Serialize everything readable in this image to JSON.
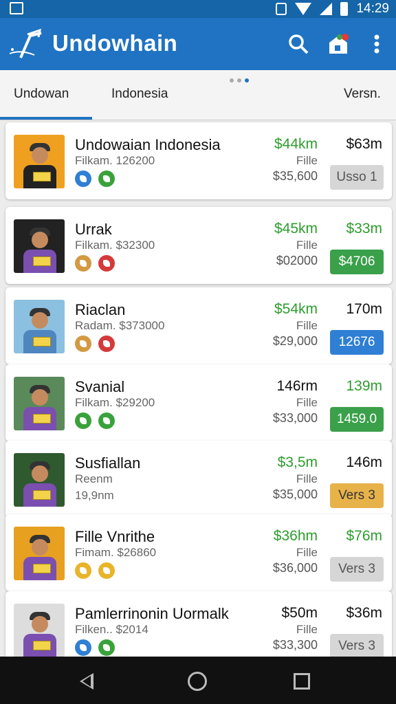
{
  "status_bar": {
    "time": "14:29"
  },
  "app_bar": {
    "title": "Undowhain",
    "accent": "#1f73c2"
  },
  "tabs": [
    {
      "label": "Undowan",
      "selected": true
    },
    {
      "label": "Indonesia",
      "selected": false
    },
    {
      "label": "Versn.",
      "selected": false
    }
  ],
  "items": [
    {
      "name": "Undowaian Indonesia",
      "sub": "Filkam. 126200",
      "sub2": "",
      "v1": "$44km",
      "v1_color": "#2e9c2e",
      "label": "Fille",
      "v3": "$35,600",
      "v2": "$63m",
      "v2_color": "#111111",
      "badge": "Usso 1",
      "badge_bg": "#d6d6d6",
      "badge_fg": "#555555",
      "icons": [
        "#2f7fd4",
        "#3aa23a"
      ],
      "thumb_bg": "#f0a020",
      "thumb_body": "#222222"
    },
    {
      "name": "Urrak",
      "sub": "Filkam. $32300",
      "sub2": "",
      "v1": "$45km",
      "v1_color": "#2e9c2e",
      "label": "Fille",
      "v3": "$02000",
      "v2": "$33m",
      "v2_color": "#2e9c2e",
      "badge": "$4706",
      "badge_bg": "#3aa04a",
      "badge_fg": "#ffffff",
      "icons": [
        "#d39a42",
        "#d43a3a"
      ],
      "thumb_bg": "#222222",
      "thumb_body": "#7a4fb0"
    },
    {
      "name": "Riaclan",
      "sub": "Radam. $373000",
      "sub2": "",
      "v1": "$54km",
      "v1_color": "#2e9c2e",
      "label": "Fille",
      "v3": "$29,000",
      "v2": "170m",
      "v2_color": "#111111",
      "badge": "12676",
      "badge_bg": "#2f7fd4",
      "badge_fg": "#ffffff",
      "icons": [
        "#d39a42",
        "#d43a3a"
      ],
      "thumb_bg": "#8cc0e0",
      "thumb_body": "#4f86c0"
    },
    {
      "name": "Svanial",
      "sub": "Filkam. $29200",
      "sub2": "",
      "v1": "146rm",
      "v1_color": "#111111",
      "label": "Fille",
      "v3": "$33,000",
      "v2": "139m",
      "v2_color": "#2e9c2e",
      "badge": "1459.0",
      "badge_bg": "#3aa04a",
      "badge_fg": "#ffffff",
      "icons": [
        "#3aa23a",
        "#3aa23a"
      ],
      "thumb_bg": "#5a8a5a",
      "thumb_body": "#7a4fb0"
    },
    {
      "name": "Susfiallan",
      "sub": "Reenm",
      "sub2": "19,9nm",
      "v1": "$3,5m",
      "v1_color": "#2e9c2e",
      "label": "Fille",
      "v3": "$35,000",
      "v2": "146m",
      "v2_color": "#111111",
      "badge": "Vers 3",
      "badge_bg": "#e8b24a",
      "badge_fg": "#333333",
      "icons": [],
      "thumb_bg": "#2f5a2f",
      "thumb_body": "#7a4fb0"
    },
    {
      "name": "Fille Vnrithe",
      "sub": "Fimam. $26860",
      "sub2": "",
      "v1": "$36hm",
      "v1_color": "#2e9c2e",
      "label": "Fille",
      "v3": "$36,000",
      "v2": "$76m",
      "v2_color": "#2e9c2e",
      "badge": "Vers 3",
      "badge_bg": "#d6d6d6",
      "badge_fg": "#555555",
      "icons": [
        "#e8b42a",
        "#e8b42a"
      ],
      "thumb_bg": "#e8a020",
      "thumb_body": "#7a4fb0"
    },
    {
      "name": "Pamlerrinonin Uormalk",
      "sub": "Filken.. $2014",
      "sub2": "",
      "v1": "$50m",
      "v1_color": "#111111",
      "label": "Fille",
      "v3": "$33,300",
      "v2": "$36m",
      "v2_color": "#111111",
      "badge": "Vers 3",
      "badge_bg": "#d6d6d6",
      "badge_fg": "#555555",
      "icons": [
        "#2f7fd4",
        "#3aa23a"
      ],
      "thumb_bg": "#dddddd",
      "thumb_body": "#7a4fb0"
    }
  ]
}
